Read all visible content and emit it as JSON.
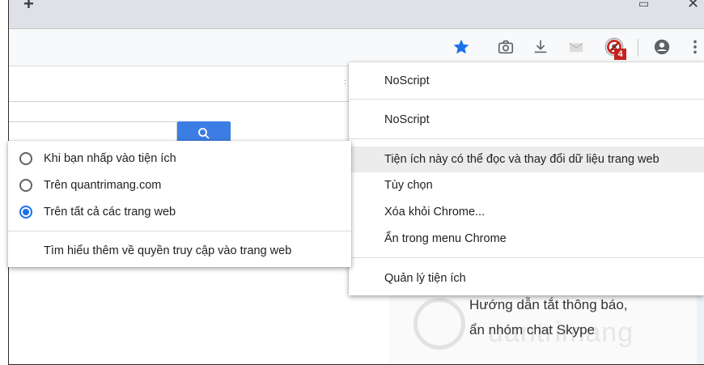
{
  "colors": {
    "accent": "#1a73e8",
    "star": "#1a73e8",
    "search_button": "#3b7de3",
    "badge": "#c5221f"
  },
  "browser": {
    "icons": [
      "new-tab-icon",
      "restore-icon",
      "close-icon",
      "star-icon",
      "camera-icon",
      "download-icon",
      "mail-icon",
      "noscript-icon",
      "account-icon",
      "more-icon"
    ],
    "noscript_badge": "4"
  },
  "extension_menu": {
    "items": [
      {
        "label": "NoScript"
      },
      {
        "label": "NoScript"
      },
      {
        "label": "Tiện ích này có thể đọc và thay đổi dữ liệu trang web"
      },
      {
        "label": "Tùy chọn"
      },
      {
        "label": "Xóa khỏi Chrome..."
      },
      {
        "label": "Ẩn trong menu Chrome"
      },
      {
        "label": "Quản lý tiện ích"
      }
    ]
  },
  "site_access_menu": {
    "options": [
      {
        "label": "Khi bạn nhấp vào tiện ích",
        "selected": false
      },
      {
        "label": "Trên quantrimang.com",
        "selected": false
      },
      {
        "label": "Trên tất cả các trang web",
        "selected": true
      }
    ],
    "learn_more": "Tìm hiểu thêm về quyền truy cập vào trang web"
  },
  "page": {
    "article_line1": "Hướng dẫn tắt thông báo,",
    "article_line2": "ẩn nhóm chat Skype",
    "watermark": "uantrimang"
  }
}
